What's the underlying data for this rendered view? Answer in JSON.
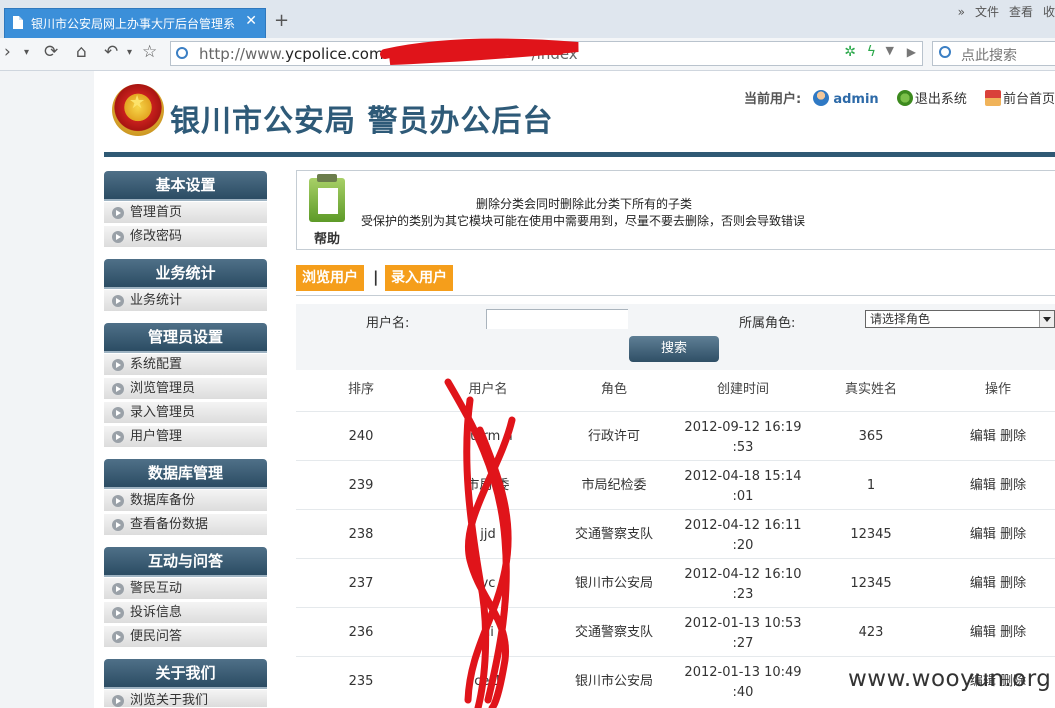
{
  "browser": {
    "tab_title": "银川市公安局网上办事大厅后台管理系",
    "tab_close": "✕",
    "new_tab": "+",
    "menus": [
      "»",
      "文件",
      "查看",
      "收"
    ],
    "url_prefix": "http://www.",
    "url_host": "ycpolice.com",
    "url_tail": "/index",
    "search_placeholder": "点此搜索"
  },
  "header": {
    "site_title": "银川市公安局 警员办公后台",
    "current_user_label": "当前用户:",
    "current_user": "admin",
    "logout": "退出系统",
    "home": "前台首页"
  },
  "sidebar": {
    "groups": [
      {
        "title": "基本设置",
        "items": [
          "管理首页",
          "修改密码"
        ]
      },
      {
        "title": "业务统计",
        "items": [
          "业务统计"
        ]
      },
      {
        "title": "管理员设置",
        "items": [
          "系统配置",
          "浏览管理员",
          "录入管理员",
          "用户管理"
        ]
      },
      {
        "title": "数据库管理",
        "items": [
          "数据库备份",
          "查看备份数据"
        ]
      },
      {
        "title": "互动与问答",
        "items": [
          "警民互动",
          "投诉信息",
          "便民问答"
        ]
      },
      {
        "title": "关于我们",
        "items": [
          "浏览关于我们"
        ]
      }
    ]
  },
  "help": {
    "label": "帮助",
    "line1": "删除分类会同时删除此分类下所有的子类",
    "line2": "受保护的类别为其它模块可能在使用中需要用到，尽量不要去删除，否则会导致错误"
  },
  "tabs": {
    "browse": "浏览用户",
    "separator": "|",
    "add": "录入用户"
  },
  "form": {
    "username_label": "用户名:",
    "username_value": "",
    "role_label": "所属角色:",
    "role_selected": "请选择角色",
    "search_button": "搜索"
  },
  "table": {
    "headers": [
      "排序",
      "用户名",
      "角色",
      "创建时间",
      "真实姓名",
      "操作"
    ],
    "edit_label": "编辑",
    "delete_label": "删除",
    "rows": [
      {
        "order": "240",
        "username": "su   rm n",
        "role": "行政许可",
        "time1": "2012-09-12 16:19",
        "time2": ":53",
        "realname": "365"
      },
      {
        "order": "239",
        "username": "市局    委",
        "role": "市局纪检委",
        "time1": "2012-04-18 15:14",
        "time2": ":01",
        "realname": "1"
      },
      {
        "order": "238",
        "username": "jjd   ",
        "role": "交通警察支队",
        "time1": "2012-04-12 16:11",
        "time2": ":20",
        "realname": "12345"
      },
      {
        "order": "237",
        "username": "yc   ",
        "role": "银川市公安局",
        "time1": "2012-04-12 16:10",
        "time2": ":23",
        "realname": "12345"
      },
      {
        "order": "236",
        "username": "   ui",
        "role": "交通警察支队",
        "time1": "2012-01-13 10:53",
        "time2": ":27",
        "realname": "423"
      },
      {
        "order": "235",
        "username": "ce   1",
        "role": "银川市公安局",
        "time1": "2012-01-13 10:49",
        "time2": ":40",
        "realname": ""
      }
    ]
  },
  "watermark": "www.wooyun.org",
  "colors": {
    "accent": "#3b8fd9",
    "tab_orange": "#f59e1b",
    "header_bar": "#2f5974",
    "title": "#2e5a78",
    "redaction": "#e0141a"
  }
}
